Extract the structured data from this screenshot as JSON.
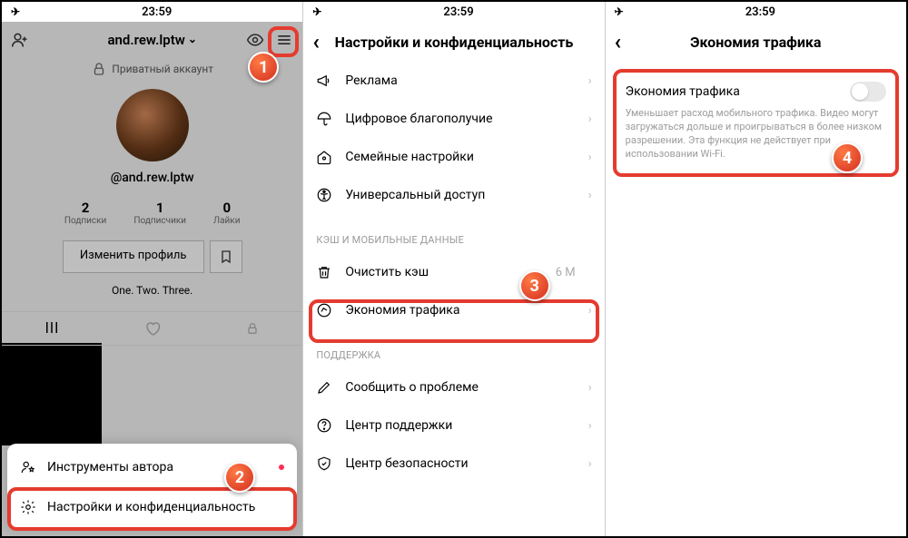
{
  "status": {
    "time": "23:59",
    "airplane": "✈︎",
    "wifi": "wifi-icon",
    "loc": "location-icon",
    "battery": "battery-icon"
  },
  "screen1": {
    "username": "and.rew.lptw",
    "private": "Приватный аккаунт",
    "handle": "@and.rew.lptw",
    "stats": {
      "following_n": "2",
      "following_l": "Подписки",
      "followers_n": "1",
      "followers_l": "Подписчики",
      "likes_n": "0",
      "likes_l": "Лайки"
    },
    "edit": "Изменить профиль",
    "bio": "One. Two. Three.",
    "sheet": {
      "tools": "Инструменты автора",
      "settings": "Настройки и конфиденциальность"
    }
  },
  "screen2": {
    "title": "Настройки и конфиденциальность",
    "ads": "Реклама",
    "wellbeing": "Цифровое благополучие",
    "family": "Семейные настройки",
    "access": "Универсальный доступ",
    "sec_cache": "КЭШ И МОБИЛЬНЫЕ ДАННЫЕ",
    "clear_cache": "Очистить кэш",
    "clear_cache_val": "6 M",
    "data_saver": "Экономия трафика",
    "sec_support": "ПОДДЕРЖКА",
    "report": "Сообщить о проблеме",
    "help": "Центр поддержки",
    "safety": "Центр безопасности"
  },
  "screen3": {
    "title": "Экономия трафика",
    "toggle_label": "Экономия трафика",
    "desc": "Уменьшает расход мобильного трафика. Видео могут загружаться дольше и проигрываться в более низком разрешении. Эта функция не действует при использовании Wi-Fi."
  },
  "badges": {
    "b1": "1",
    "b2": "2",
    "b3": "3",
    "b4": "4"
  }
}
